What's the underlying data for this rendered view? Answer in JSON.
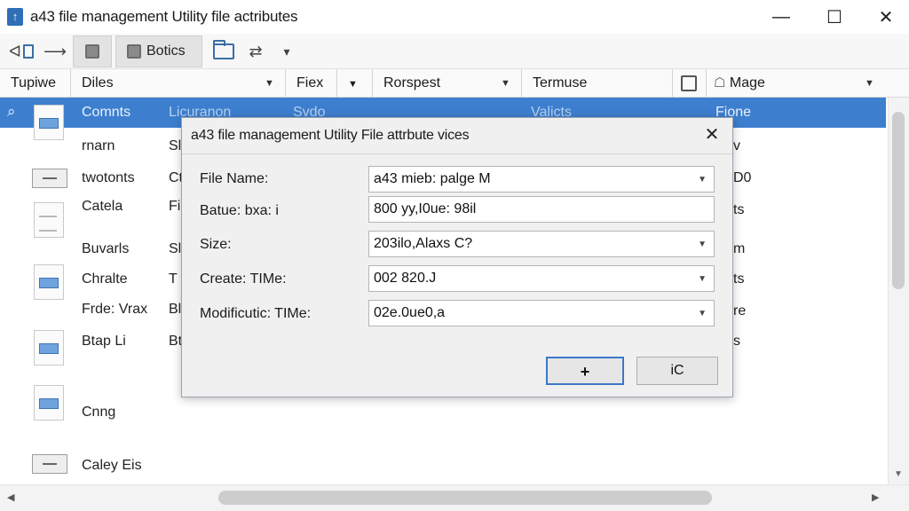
{
  "window": {
    "title": "a43 file management Utility file actributes",
    "minimize": "—",
    "maximize": "☐",
    "close": "✕"
  },
  "toolbar": {
    "back_label": "ᐊ",
    "forward_label": "⟶",
    "botics_label": "Botics",
    "share_label": "⇄",
    "dropdown_label": "▾"
  },
  "columns": [
    {
      "label": "Tupiwe"
    },
    {
      "label": "Diles"
    },
    {
      "label": "Fiex"
    },
    {
      "label": "Rorspest"
    },
    {
      "label": "Termuse"
    },
    {
      "label": "Mage"
    }
  ],
  "list": {
    "selected_row": {
      "name": "Comnts",
      "col2": "Licuranon",
      "col3": "Svdo",
      "col4": "Valicts",
      "col6": "Fione"
    },
    "rows": [
      {
        "name": "rnarn",
        "col2": "Sl",
        "tail": "v"
      },
      {
        "name": "twotonts",
        "col2": "Ct",
        "tail": "D0"
      },
      {
        "name": "Catela",
        "col2": "Fi",
        "tail": "ts"
      },
      {
        "name": "Buvarls",
        "col2": "Sl",
        "tail": "m"
      },
      {
        "name": "Chralte",
        "col2": "T",
        "tail": "ts"
      },
      {
        "name": "Frde: Vrax",
        "col2": "Bl",
        "tail": "re"
      },
      {
        "name": "Btap Li",
        "col2": "Bt",
        "tail": "s"
      },
      {
        "name": "Cnng",
        "col2": "",
        "tail": ""
      },
      {
        "name": "Caley Eis",
        "col2": "",
        "tail": ""
      }
    ]
  },
  "dialog": {
    "title": "a43 file management Utility File attrbute vices",
    "close": "✕",
    "fields": [
      {
        "label": "File Name:",
        "value": "a43 mieb: palge M"
      },
      {
        "label": "Batue: bxa: i",
        "value": "800 yy,I0ue: 98il"
      },
      {
        "label": "Size:",
        "value": "203ilo,Alaxs C?"
      },
      {
        "label": "Create: TIMe:",
        "value": "002 820.J"
      },
      {
        "label": "Modificutic: TIMe:",
        "value": "02e.0ue0,a"
      }
    ],
    "ok_label": "+",
    "cancel_label": "iC"
  },
  "colors": {
    "accent": "#3d7fce",
    "dialog_bg": "#f0f0f0",
    "primary_button_border": "#3b78c9"
  }
}
